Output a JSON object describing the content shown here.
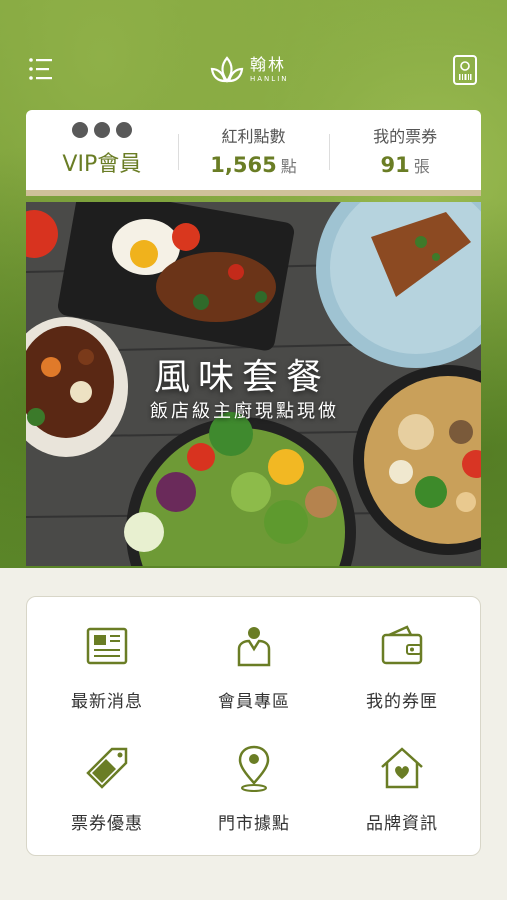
{
  "header": {
    "logo_cn": "翰林",
    "logo_en": "HANLIN"
  },
  "stats": {
    "vip_label": "VIP會員",
    "points_label": "紅利點數",
    "points_value": "1,565",
    "points_unit": "點",
    "tickets_label": "我的票券",
    "tickets_value": "91",
    "tickets_unit": "張"
  },
  "banner": {
    "title": "風味套餐",
    "subtitle": "飯店級主廚現點現做"
  },
  "menu": [
    {
      "label": "最新消息",
      "icon": "newspaper-icon"
    },
    {
      "label": "會員專區",
      "icon": "member-icon"
    },
    {
      "label": "我的券匣",
      "icon": "wallet-icon"
    },
    {
      "label": "票券優惠",
      "icon": "tag-icon"
    },
    {
      "label": "門市據點",
      "icon": "location-pin-icon"
    },
    {
      "label": "品牌資訊",
      "icon": "house-heart-icon"
    }
  ],
  "colors": {
    "accent_green": "#6a7d25",
    "header_green": "#7fa43c",
    "divider_gold": "#cfc19a"
  }
}
